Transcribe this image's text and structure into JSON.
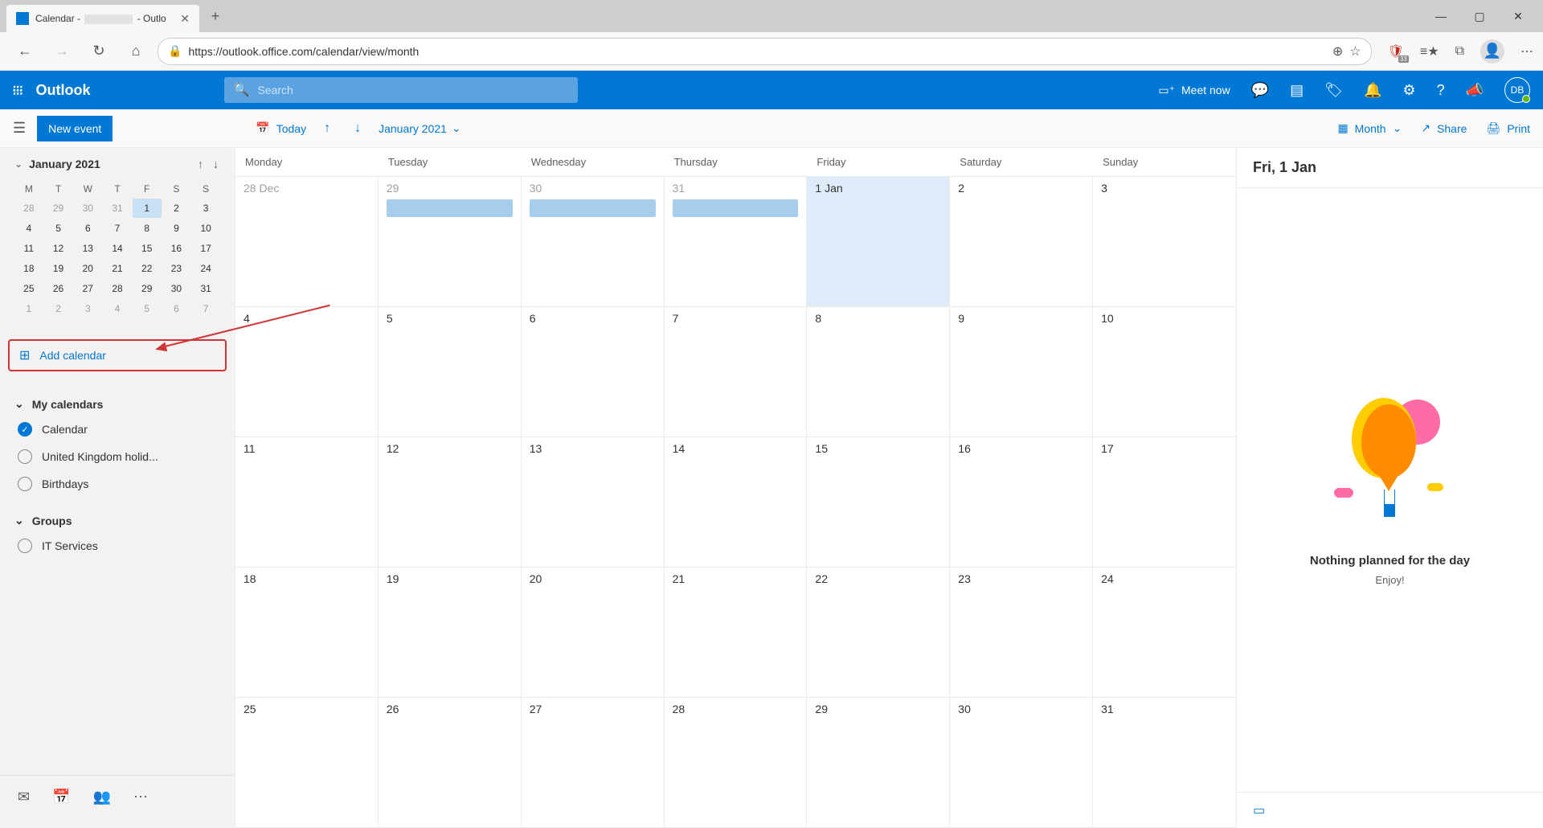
{
  "browser": {
    "tab_prefix": "Calendar - ",
    "tab_suffix": " - Outlo",
    "url": "https://outlook.office.com/calendar/view/month",
    "ext_badge": "33"
  },
  "outlook_header": {
    "app_name": "Outlook",
    "search_placeholder": "Search",
    "meet_now": "Meet now",
    "avatar_initials": "DB"
  },
  "command_bar": {
    "new_event": "New event",
    "today": "Today",
    "current_month": "January 2021",
    "view_label": "Month",
    "share": "Share",
    "print": "Print"
  },
  "mini_calendar": {
    "title": "January 2021",
    "dow": [
      "M",
      "T",
      "W",
      "T",
      "F",
      "S",
      "S"
    ],
    "rows": [
      [
        {
          "d": "28",
          "o": true
        },
        {
          "d": "29",
          "o": true
        },
        {
          "d": "30",
          "o": true
        },
        {
          "d": "31",
          "o": true
        },
        {
          "d": "1",
          "sel": true
        },
        {
          "d": "2"
        },
        {
          "d": "3"
        }
      ],
      [
        {
          "d": "4"
        },
        {
          "d": "5"
        },
        {
          "d": "6"
        },
        {
          "d": "7"
        },
        {
          "d": "8"
        },
        {
          "d": "9"
        },
        {
          "d": "10"
        }
      ],
      [
        {
          "d": "11"
        },
        {
          "d": "12"
        },
        {
          "d": "13"
        },
        {
          "d": "14"
        },
        {
          "d": "15"
        },
        {
          "d": "16"
        },
        {
          "d": "17"
        }
      ],
      [
        {
          "d": "18"
        },
        {
          "d": "19"
        },
        {
          "d": "20"
        },
        {
          "d": "21"
        },
        {
          "d": "22"
        },
        {
          "d": "23"
        },
        {
          "d": "24"
        }
      ],
      [
        {
          "d": "25"
        },
        {
          "d": "26"
        },
        {
          "d": "27"
        },
        {
          "d": "28"
        },
        {
          "d": "29"
        },
        {
          "d": "30"
        },
        {
          "d": "31"
        }
      ],
      [
        {
          "d": "1",
          "o": true
        },
        {
          "d": "2",
          "o": true
        },
        {
          "d": "3",
          "o": true
        },
        {
          "d": "4",
          "o": true
        },
        {
          "d": "5",
          "o": true
        },
        {
          "d": "6",
          "o": true
        },
        {
          "d": "7",
          "o": true
        }
      ]
    ]
  },
  "add_calendar": "Add calendar",
  "sections": {
    "my_calendars": "My calendars",
    "groups": "Groups"
  },
  "calendars": [
    {
      "name": "Calendar",
      "checked": true
    },
    {
      "name": "United Kingdom holid...",
      "checked": false
    },
    {
      "name": "Birthdays",
      "checked": false
    }
  ],
  "group_calendars": [
    {
      "name": "IT Services",
      "checked": false
    }
  ],
  "main_calendar": {
    "dow": [
      "Monday",
      "Tuesday",
      "Wednesday",
      "Thursday",
      "Friday",
      "Saturday",
      "Sunday"
    ],
    "weeks": [
      [
        {
          "l": "28 Dec",
          "o": true
        },
        {
          "l": "29",
          "o": true,
          "ev": true
        },
        {
          "l": "30",
          "o": true,
          "ev": true
        },
        {
          "l": "31",
          "o": true,
          "ev": true
        },
        {
          "l": "1 Jan",
          "today": true
        },
        {
          "l": "2"
        },
        {
          "l": "3"
        }
      ],
      [
        {
          "l": "4"
        },
        {
          "l": "5"
        },
        {
          "l": "6"
        },
        {
          "l": "7"
        },
        {
          "l": "8"
        },
        {
          "l": "9"
        },
        {
          "l": "10"
        }
      ],
      [
        {
          "l": "11"
        },
        {
          "l": "12"
        },
        {
          "l": "13"
        },
        {
          "l": "14"
        },
        {
          "l": "15"
        },
        {
          "l": "16"
        },
        {
          "l": "17"
        }
      ],
      [
        {
          "l": "18"
        },
        {
          "l": "19"
        },
        {
          "l": "20"
        },
        {
          "l": "21"
        },
        {
          "l": "22"
        },
        {
          "l": "23"
        },
        {
          "l": "24"
        }
      ],
      [
        {
          "l": "25"
        },
        {
          "l": "26"
        },
        {
          "l": "27"
        },
        {
          "l": "28"
        },
        {
          "l": "29"
        },
        {
          "l": "30"
        },
        {
          "l": "31"
        }
      ]
    ]
  },
  "right_panel": {
    "date_label": "Fri, 1 Jan",
    "empty_title": "Nothing planned for the day",
    "empty_sub": "Enjoy!"
  }
}
